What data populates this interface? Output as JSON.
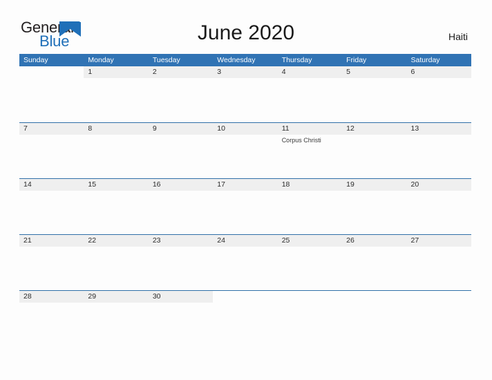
{
  "brand": {
    "name_part1": "General",
    "name_part2": "Blue",
    "triangle_color": "#1f6fb8",
    "text_color": "#231f20"
  },
  "header": {
    "title": "June 2020",
    "country": "Haiti"
  },
  "theme": {
    "header_blue": "#3073b4",
    "row_border_blue": "#2f6fa8",
    "date_band_gray": "#efefef",
    "page_background": "#fdfdfd"
  },
  "weekdays": [
    "Sunday",
    "Monday",
    "Tuesday",
    "Wednesday",
    "Thursday",
    "Friday",
    "Saturday"
  ],
  "weeks": [
    [
      {
        "date": "",
        "events": []
      },
      {
        "date": "1",
        "events": []
      },
      {
        "date": "2",
        "events": []
      },
      {
        "date": "3",
        "events": []
      },
      {
        "date": "4",
        "events": []
      },
      {
        "date": "5",
        "events": []
      },
      {
        "date": "6",
        "events": []
      }
    ],
    [
      {
        "date": "7",
        "events": []
      },
      {
        "date": "8",
        "events": []
      },
      {
        "date": "9",
        "events": []
      },
      {
        "date": "10",
        "events": []
      },
      {
        "date": "11",
        "events": [
          "Corpus Christi"
        ]
      },
      {
        "date": "12",
        "events": []
      },
      {
        "date": "13",
        "events": []
      }
    ],
    [
      {
        "date": "14",
        "events": []
      },
      {
        "date": "15",
        "events": []
      },
      {
        "date": "16",
        "events": []
      },
      {
        "date": "17",
        "events": []
      },
      {
        "date": "18",
        "events": []
      },
      {
        "date": "19",
        "events": []
      },
      {
        "date": "20",
        "events": []
      }
    ],
    [
      {
        "date": "21",
        "events": []
      },
      {
        "date": "22",
        "events": []
      },
      {
        "date": "23",
        "events": []
      },
      {
        "date": "24",
        "events": []
      },
      {
        "date": "25",
        "events": []
      },
      {
        "date": "26",
        "events": []
      },
      {
        "date": "27",
        "events": []
      }
    ],
    [
      {
        "date": "28",
        "events": []
      },
      {
        "date": "29",
        "events": []
      },
      {
        "date": "30",
        "events": []
      },
      {
        "date": "",
        "events": []
      },
      {
        "date": "",
        "events": []
      },
      {
        "date": "",
        "events": []
      },
      {
        "date": "",
        "events": []
      }
    ]
  ]
}
